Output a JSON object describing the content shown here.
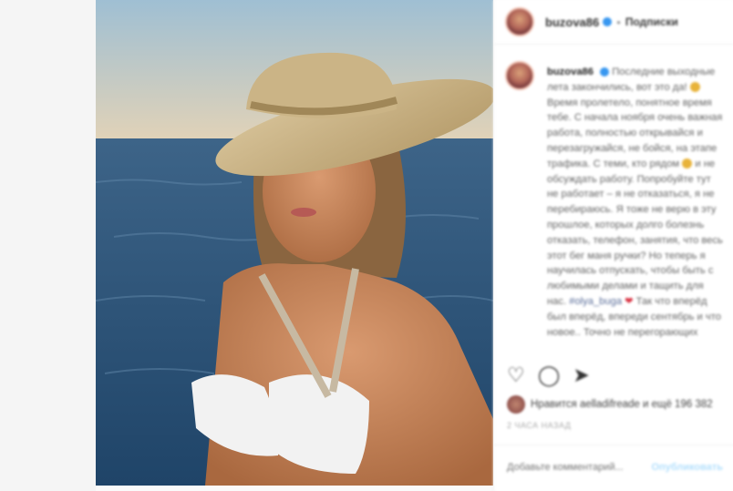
{
  "header": {
    "username": "buzova86",
    "follow": "Подписки"
  },
  "caption": {
    "username": "buzova86",
    "text_1": "Последние выходные лета закончились, вот это да!",
    "text_2": "Время пролетело, понятное время тебе. С начала ноября очень важная работа, полностью открывайся и перезагружайся, не бойся, на этапе трафика. С теми, кто рядом",
    "text_3": "и не обсуждать работу.",
    "text_4": "Попробуйте тут не работает – я не отказаться, я не перебираюсь. Я тоже не верю в эту прошлое, которых долго болезнь отказать, телефон, занятия, что весь этот бег маня ручки? Но теперь я научилась отпускать, чтобы быть с любимыми делами и тащить для нас.",
    "hashtag": "#olya_buga",
    "text_5": "Так что вперёд был вперёд, впереди сентябрь и что новое.. Точно не перегорающих"
  },
  "likes": {
    "text": "Нравится aelladifreade и ещё 196 382"
  },
  "timestamp": "2 ЧАСА НАЗАД",
  "comment": {
    "placeholder": "Добавьте комментарий...",
    "publish": "Опубликовать"
  },
  "icons": {
    "like": "heart-icon",
    "comment": "comment-icon",
    "share": "share-icon"
  }
}
